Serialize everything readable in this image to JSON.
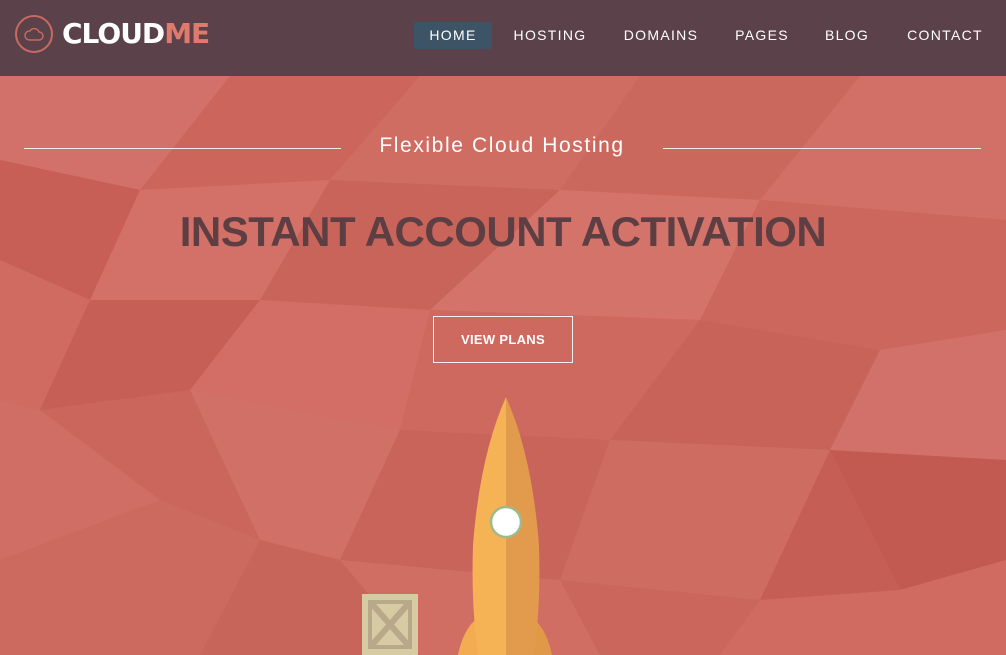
{
  "brand": {
    "name_part1": "CLOUD",
    "name_part2": "ME",
    "logo_icon": "cloud-icon",
    "colors": {
      "header_bg": "#5b4149",
      "accent": "#e07a6c",
      "hero_bg": "#cf6a5f",
      "active_nav": "#3d5366"
    }
  },
  "nav": {
    "items": [
      {
        "label": "HOME",
        "active": true
      },
      {
        "label": "HOSTING",
        "active": false
      },
      {
        "label": "DOMAINS",
        "active": false
      },
      {
        "label": "PAGES",
        "active": false
      },
      {
        "label": "BLOG",
        "active": false
      },
      {
        "label": "CONTACT",
        "active": false
      }
    ]
  },
  "hero": {
    "tagline": "Flexible Cloud Hosting",
    "headline": "INSTANT ACCOUNT ACTIVATION",
    "cta_label": "VIEW PLANS",
    "illustration": "rocket-icon",
    "decoration": "crate-icon"
  }
}
